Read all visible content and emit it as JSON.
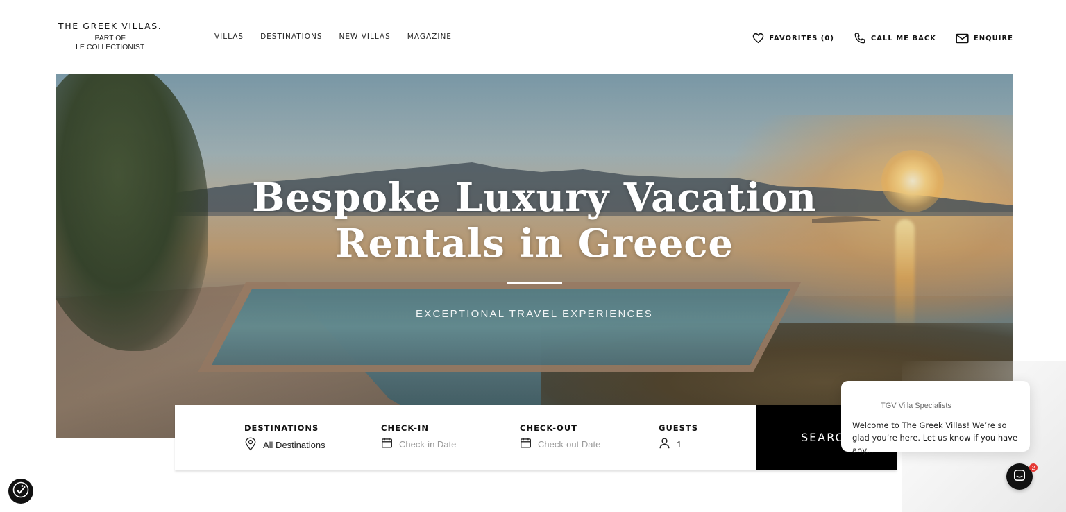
{
  "header": {
    "brand": "THE GREEK VILLAS.",
    "sub_line1": "PART OF",
    "sub_line2": "LE COLLECTIONIST",
    "nav": [
      "VILLAS",
      "DESTINATIONS",
      "NEW VILLAS",
      "MAGAZINE"
    ],
    "favorites_label": "FAVORITES (0)",
    "call_label": "CALL ME BACK",
    "enquire_label": "ENQUIRE"
  },
  "hero": {
    "title_line1": "Bespoke Luxury Vacation",
    "title_line2": "Rentals in Greece",
    "subtitle": "EXCEPTIONAL TRAVEL EXPERIENCES"
  },
  "search": {
    "destinations_label": "DESTINATIONS",
    "destinations_value": "All Destinations",
    "checkin_label": "CHECK-IN",
    "checkin_placeholder": "Check-in Date",
    "checkout_label": "CHECK-OUT",
    "checkout_placeholder": "Check-out Date",
    "guests_label": "GUESTS",
    "guests_value": "1",
    "button_label": "SEARC"
  },
  "chat": {
    "sender": "TGV Villa Specialists",
    "message": "Welcome to The Greek Villas! We’re so glad you’re here. Let us know if you have any...",
    "badge_count": "2"
  },
  "colors": {
    "primary": "#000000",
    "badge": "#e53935",
    "placeholder": "#9a9a9a"
  },
  "icons": [
    "heart-icon",
    "phone-icon",
    "mail-icon",
    "location-pin-icon",
    "calendar-icon",
    "user-icon",
    "chat-icon",
    "accessibility-icon"
  ]
}
